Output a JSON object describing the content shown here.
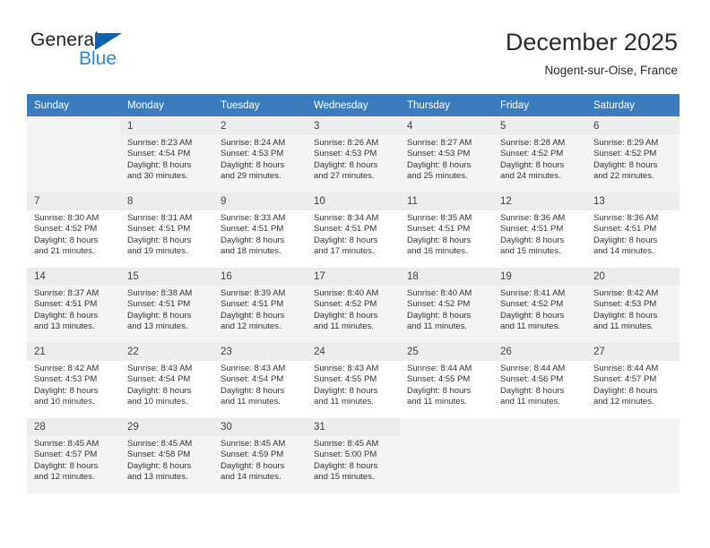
{
  "brand": {
    "name_part1": "General",
    "name_part2": "Blue",
    "logo_icon": "triangle-logo-icon"
  },
  "header": {
    "title": "December 2025",
    "location": "Nogent-sur-Oise, France"
  },
  "colors": {
    "header_row": "#3a7cbe",
    "brand_dark": "#231f20",
    "brand_blue": "#2e86d4",
    "logo_blue": "#1263ab",
    "alt_row": "#f4f4f4",
    "daynum_bg": "#ececec"
  },
  "weekday_headers": [
    "Sunday",
    "Monday",
    "Tuesday",
    "Wednesday",
    "Thursday",
    "Friday",
    "Saturday"
  ],
  "weeks": [
    [
      {
        "day": "",
        "sunrise": "",
        "sunset": "",
        "daylight_line1": "",
        "daylight_line2": "",
        "empty": true
      },
      {
        "day": "1",
        "sunrise": "Sunrise: 8:23 AM",
        "sunset": "Sunset: 4:54 PM",
        "daylight_line1": "Daylight: 8 hours",
        "daylight_line2": "and 30 minutes.",
        "empty": false
      },
      {
        "day": "2",
        "sunrise": "Sunrise: 8:24 AM",
        "sunset": "Sunset: 4:53 PM",
        "daylight_line1": "Daylight: 8 hours",
        "daylight_line2": "and 29 minutes.",
        "empty": false
      },
      {
        "day": "3",
        "sunrise": "Sunrise: 8:26 AM",
        "sunset": "Sunset: 4:53 PM",
        "daylight_line1": "Daylight: 8 hours",
        "daylight_line2": "and 27 minutes.",
        "empty": false
      },
      {
        "day": "4",
        "sunrise": "Sunrise: 8:27 AM",
        "sunset": "Sunset: 4:53 PM",
        "daylight_line1": "Daylight: 8 hours",
        "daylight_line2": "and 25 minutes.",
        "empty": false
      },
      {
        "day": "5",
        "sunrise": "Sunrise: 8:28 AM",
        "sunset": "Sunset: 4:52 PM",
        "daylight_line1": "Daylight: 8 hours",
        "daylight_line2": "and 24 minutes.",
        "empty": false
      },
      {
        "day": "6",
        "sunrise": "Sunrise: 8:29 AM",
        "sunset": "Sunset: 4:52 PM",
        "daylight_line1": "Daylight: 8 hours",
        "daylight_line2": "and 22 minutes.",
        "empty": false
      }
    ],
    [
      {
        "day": "7",
        "sunrise": "Sunrise: 8:30 AM",
        "sunset": "Sunset: 4:52 PM",
        "daylight_line1": "Daylight: 8 hours",
        "daylight_line2": "and 21 minutes.",
        "empty": false
      },
      {
        "day": "8",
        "sunrise": "Sunrise: 8:31 AM",
        "sunset": "Sunset: 4:51 PM",
        "daylight_line1": "Daylight: 8 hours",
        "daylight_line2": "and 19 minutes.",
        "empty": false
      },
      {
        "day": "9",
        "sunrise": "Sunrise: 8:33 AM",
        "sunset": "Sunset: 4:51 PM",
        "daylight_line1": "Daylight: 8 hours",
        "daylight_line2": "and 18 minutes.",
        "empty": false
      },
      {
        "day": "10",
        "sunrise": "Sunrise: 8:34 AM",
        "sunset": "Sunset: 4:51 PM",
        "daylight_line1": "Daylight: 8 hours",
        "daylight_line2": "and 17 minutes.",
        "empty": false
      },
      {
        "day": "11",
        "sunrise": "Sunrise: 8:35 AM",
        "sunset": "Sunset: 4:51 PM",
        "daylight_line1": "Daylight: 8 hours",
        "daylight_line2": "and 16 minutes.",
        "empty": false
      },
      {
        "day": "12",
        "sunrise": "Sunrise: 8:36 AM",
        "sunset": "Sunset: 4:51 PM",
        "daylight_line1": "Daylight: 8 hours",
        "daylight_line2": "and 15 minutes.",
        "empty": false
      },
      {
        "day": "13",
        "sunrise": "Sunrise: 8:36 AM",
        "sunset": "Sunset: 4:51 PM",
        "daylight_line1": "Daylight: 8 hours",
        "daylight_line2": "and 14 minutes.",
        "empty": false
      }
    ],
    [
      {
        "day": "14",
        "sunrise": "Sunrise: 8:37 AM",
        "sunset": "Sunset: 4:51 PM",
        "daylight_line1": "Daylight: 8 hours",
        "daylight_line2": "and 13 minutes.",
        "empty": false
      },
      {
        "day": "15",
        "sunrise": "Sunrise: 8:38 AM",
        "sunset": "Sunset: 4:51 PM",
        "daylight_line1": "Daylight: 8 hours",
        "daylight_line2": "and 13 minutes.",
        "empty": false
      },
      {
        "day": "16",
        "sunrise": "Sunrise: 8:39 AM",
        "sunset": "Sunset: 4:51 PM",
        "daylight_line1": "Daylight: 8 hours",
        "daylight_line2": "and 12 minutes.",
        "empty": false
      },
      {
        "day": "17",
        "sunrise": "Sunrise: 8:40 AM",
        "sunset": "Sunset: 4:52 PM",
        "daylight_line1": "Daylight: 8 hours",
        "daylight_line2": "and 11 minutes.",
        "empty": false
      },
      {
        "day": "18",
        "sunrise": "Sunrise: 8:40 AM",
        "sunset": "Sunset: 4:52 PM",
        "daylight_line1": "Daylight: 8 hours",
        "daylight_line2": "and 11 minutes.",
        "empty": false
      },
      {
        "day": "19",
        "sunrise": "Sunrise: 8:41 AM",
        "sunset": "Sunset: 4:52 PM",
        "daylight_line1": "Daylight: 8 hours",
        "daylight_line2": "and 11 minutes.",
        "empty": false
      },
      {
        "day": "20",
        "sunrise": "Sunrise: 8:42 AM",
        "sunset": "Sunset: 4:53 PM",
        "daylight_line1": "Daylight: 8 hours",
        "daylight_line2": "and 11 minutes.",
        "empty": false
      }
    ],
    [
      {
        "day": "21",
        "sunrise": "Sunrise: 8:42 AM",
        "sunset": "Sunset: 4:53 PM",
        "daylight_line1": "Daylight: 8 hours",
        "daylight_line2": "and 10 minutes.",
        "empty": false
      },
      {
        "day": "22",
        "sunrise": "Sunrise: 8:43 AM",
        "sunset": "Sunset: 4:54 PM",
        "daylight_line1": "Daylight: 8 hours",
        "daylight_line2": "and 10 minutes.",
        "empty": false
      },
      {
        "day": "23",
        "sunrise": "Sunrise: 8:43 AM",
        "sunset": "Sunset: 4:54 PM",
        "daylight_line1": "Daylight: 8 hours",
        "daylight_line2": "and 11 minutes.",
        "empty": false
      },
      {
        "day": "24",
        "sunrise": "Sunrise: 8:43 AM",
        "sunset": "Sunset: 4:55 PM",
        "daylight_line1": "Daylight: 8 hours",
        "daylight_line2": "and 11 minutes.",
        "empty": false
      },
      {
        "day": "25",
        "sunrise": "Sunrise: 8:44 AM",
        "sunset": "Sunset: 4:55 PM",
        "daylight_line1": "Daylight: 8 hours",
        "daylight_line2": "and 11 minutes.",
        "empty": false
      },
      {
        "day": "26",
        "sunrise": "Sunrise: 8:44 AM",
        "sunset": "Sunset: 4:56 PM",
        "daylight_line1": "Daylight: 8 hours",
        "daylight_line2": "and 11 minutes.",
        "empty": false
      },
      {
        "day": "27",
        "sunrise": "Sunrise: 8:44 AM",
        "sunset": "Sunset: 4:57 PM",
        "daylight_line1": "Daylight: 8 hours",
        "daylight_line2": "and 12 minutes.",
        "empty": false
      }
    ],
    [
      {
        "day": "28",
        "sunrise": "Sunrise: 8:45 AM",
        "sunset": "Sunset: 4:57 PM",
        "daylight_line1": "Daylight: 8 hours",
        "daylight_line2": "and 12 minutes.",
        "empty": false
      },
      {
        "day": "29",
        "sunrise": "Sunrise: 8:45 AM",
        "sunset": "Sunset: 4:58 PM",
        "daylight_line1": "Daylight: 8 hours",
        "daylight_line2": "and 13 minutes.",
        "empty": false
      },
      {
        "day": "30",
        "sunrise": "Sunrise: 8:45 AM",
        "sunset": "Sunset: 4:59 PM",
        "daylight_line1": "Daylight: 8 hours",
        "daylight_line2": "and 14 minutes.",
        "empty": false
      },
      {
        "day": "31",
        "sunrise": "Sunrise: 8:45 AM",
        "sunset": "Sunset: 5:00 PM",
        "daylight_line1": "Daylight: 8 hours",
        "daylight_line2": "and 15 minutes.",
        "empty": false
      },
      {
        "day": "",
        "sunrise": "",
        "sunset": "",
        "daylight_line1": "",
        "daylight_line2": "",
        "empty": true
      },
      {
        "day": "",
        "sunrise": "",
        "sunset": "",
        "daylight_line1": "",
        "daylight_line2": "",
        "empty": true
      },
      {
        "day": "",
        "sunrise": "",
        "sunset": "",
        "daylight_line1": "",
        "daylight_line2": "",
        "empty": true
      }
    ]
  ]
}
